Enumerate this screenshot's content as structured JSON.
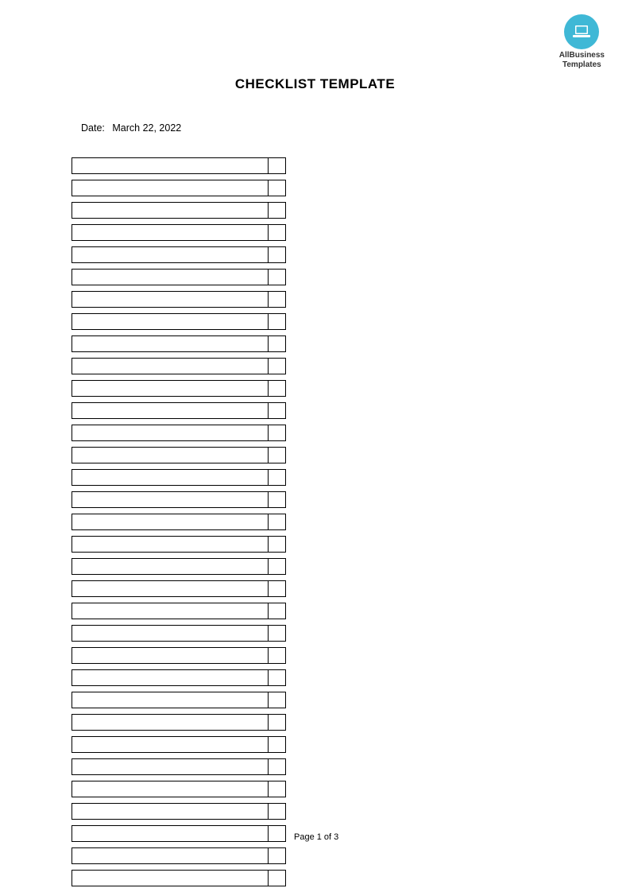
{
  "logo": {
    "line1": "AllBusiness",
    "line2": "Templates"
  },
  "title": "CHECKLIST TEMPLATE",
  "date": {
    "label": "Date:",
    "value": "March 22, 2022"
  },
  "rows": [
    {
      "item": "",
      "check": ""
    },
    {
      "item": "",
      "check": ""
    },
    {
      "item": "",
      "check": ""
    },
    {
      "item": "",
      "check": ""
    },
    {
      "item": "",
      "check": ""
    },
    {
      "item": "",
      "check": ""
    },
    {
      "item": "",
      "check": ""
    },
    {
      "item": "",
      "check": ""
    },
    {
      "item": "",
      "check": ""
    },
    {
      "item": "",
      "check": ""
    },
    {
      "item": "",
      "check": ""
    },
    {
      "item": "",
      "check": ""
    },
    {
      "item": "",
      "check": ""
    },
    {
      "item": "",
      "check": ""
    },
    {
      "item": "",
      "check": ""
    },
    {
      "item": "",
      "check": ""
    },
    {
      "item": "",
      "check": ""
    },
    {
      "item": "",
      "check": ""
    },
    {
      "item": "",
      "check": ""
    },
    {
      "item": "",
      "check": ""
    },
    {
      "item": "",
      "check": ""
    },
    {
      "item": "",
      "check": ""
    },
    {
      "item": "",
      "check": ""
    },
    {
      "item": "",
      "check": ""
    },
    {
      "item": "",
      "check": ""
    },
    {
      "item": "",
      "check": ""
    },
    {
      "item": "",
      "check": ""
    },
    {
      "item": "",
      "check": ""
    },
    {
      "item": "",
      "check": ""
    },
    {
      "item": "",
      "check": ""
    },
    {
      "item": "",
      "check": ""
    },
    {
      "item": "",
      "check": ""
    },
    {
      "item": "",
      "check": ""
    }
  ],
  "footer": {
    "page": "Page 1 of 3"
  }
}
